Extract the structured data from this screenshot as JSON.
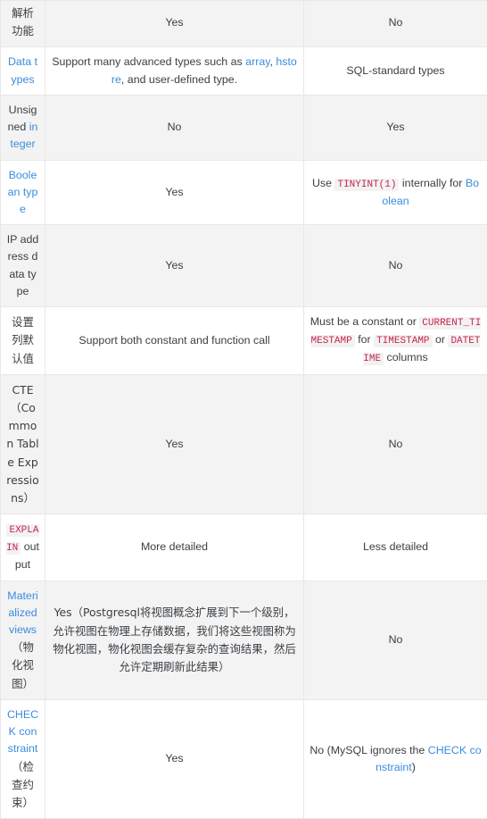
{
  "page": {
    "title": "PostgreSQL vs MySQL feature comparison table",
    "columns": 3,
    "colors": {
      "link": "#3b8cde",
      "code_text": "#c7254e",
      "code_bg": "#f2f2f2",
      "row_alt_bg": "#f3f3f3",
      "row_bg": "#ffffff",
      "border": "#e8e8e8",
      "text": "#3b4045"
    }
  },
  "table": {
    "rows": [
      {
        "id": "parse-function",
        "feature_plain": "解析功能",
        "feature_parts": [
          {
            "text": "解析功能",
            "kind": "text"
          }
        ],
        "postgres": "Yes",
        "postgres_parts": [
          {
            "text": "Yes",
            "kind": "text"
          }
        ],
        "mysql": "No",
        "mysql_parts": [
          {
            "text": "No",
            "kind": "text"
          }
        ],
        "shade": "odd"
      },
      {
        "id": "data-types",
        "feature_plain": "Data types",
        "feature_parts": [
          {
            "text": "Data types",
            "kind": "link"
          }
        ],
        "postgres": "Support many advanced types such as array, hstore, and user-defined type.",
        "postgres_parts": [
          {
            "text": "Support many advanced types such as ",
            "kind": "text"
          },
          {
            "text": "array",
            "kind": "link"
          },
          {
            "text": ", ",
            "kind": "text"
          },
          {
            "text": "hstore",
            "kind": "link"
          },
          {
            "text": ", and user-defined type.",
            "kind": "text"
          }
        ],
        "mysql": "SQL-standard types",
        "mysql_parts": [
          {
            "text": "SQL-standard types",
            "kind": "text"
          }
        ],
        "shade": "even"
      },
      {
        "id": "unsigned-integer",
        "feature_plain": "Unsigned integer",
        "feature_parts": [
          {
            "text": "Unsig ned ",
            "kind": "text"
          },
          {
            "text": "integer",
            "kind": "link"
          }
        ],
        "postgres": "No",
        "postgres_parts": [
          {
            "text": "No",
            "kind": "text"
          }
        ],
        "mysql": "Yes",
        "mysql_parts": [
          {
            "text": "Yes",
            "kind": "text"
          }
        ],
        "shade": "odd"
      },
      {
        "id": "boolean-type",
        "feature_plain": "Boolean type",
        "feature_parts": [
          {
            "text": "Boolean type",
            "kind": "link"
          }
        ],
        "postgres": "Yes",
        "postgres_parts": [
          {
            "text": "Yes",
            "kind": "text"
          }
        ],
        "mysql": "Use TINYINT(1) internally for Boolean",
        "mysql_parts": [
          {
            "text": "Use ",
            "kind": "text"
          },
          {
            "text": "TINYINT(1)",
            "kind": "code"
          },
          {
            "text": " internally for ",
            "kind": "text"
          },
          {
            "text": "Boolean",
            "kind": "link"
          }
        ],
        "shade": "even"
      },
      {
        "id": "ip-address-data-type",
        "feature_plain": "IP address data type",
        "feature_parts": [
          {
            "text": "IP address data type",
            "kind": "text"
          }
        ],
        "postgres": "Yes",
        "postgres_parts": [
          {
            "text": "Yes",
            "kind": "text"
          }
        ],
        "mysql": "No",
        "mysql_parts": [
          {
            "text": "No",
            "kind": "text"
          }
        ],
        "shade": "odd"
      },
      {
        "id": "column-default-value",
        "feature_plain": "设置列默认值",
        "feature_parts": [
          {
            "text": "设置列默认值",
            "kind": "text"
          }
        ],
        "postgres": "Support both constant and function call",
        "postgres_parts": [
          {
            "text": "Support both constant and function call",
            "kind": "text"
          }
        ],
        "mysql": "Must be a constant or CURRENT_TIMESTAMP for TIMESTAMP or DATETIME columns",
        "mysql_parts": [
          {
            "text": "Must be a constant or ",
            "kind": "text"
          },
          {
            "text": "CURRENT_TIMESTAMP",
            "kind": "code"
          },
          {
            "text": " for ",
            "kind": "text"
          },
          {
            "text": "TIMESTAMP",
            "kind": "code"
          },
          {
            "text": " or ",
            "kind": "text"
          },
          {
            "text": "DATETIME",
            "kind": "code"
          },
          {
            "text": " columns",
            "kind": "text"
          }
        ],
        "shade": "even"
      },
      {
        "id": "cte",
        "feature_plain": "CTE（Common Table Expressions）",
        "feature_parts": [
          {
            "text": "CTE（Common Table Expressions）",
            "kind": "text"
          }
        ],
        "postgres": "Yes",
        "postgres_parts": [
          {
            "text": "Yes",
            "kind": "text"
          }
        ],
        "mysql": "No",
        "mysql_parts": [
          {
            "text": "No",
            "kind": "text"
          }
        ],
        "shade": "odd"
      },
      {
        "id": "explain-output",
        "feature_plain": "EXPLAIN output",
        "feature_parts": [
          {
            "text": "EXPLAIN",
            "kind": "code"
          },
          {
            "text": " output",
            "kind": "text"
          }
        ],
        "postgres": "More detailed",
        "postgres_parts": [
          {
            "text": "More detailed",
            "kind": "text"
          }
        ],
        "mysql": "Less detailed",
        "mysql_parts": [
          {
            "text": "Less detailed",
            "kind": "text"
          }
        ],
        "shade": "even"
      },
      {
        "id": "materialized-views",
        "feature_plain": "Materialized views（物化视图）",
        "feature_parts": [
          {
            "text": "Materialized views",
            "kind": "link"
          },
          {
            "text": "（物化视图）",
            "kind": "text"
          }
        ],
        "postgres": "Yes（Postgresql将视图概念扩展到下一个级别，允许视图在物理上存储数据，我们将这些视图称为物化视图，物化视图会缓存复杂的查询结果，然后允许定期刷新此结果）",
        "postgres_parts": [
          {
            "text": "Yes（Postgresql将视图概念扩展到下一个级别，允许视图在物理上存储数据，我们将这些视图称为物化视图，物化视图会缓存复杂的查询结果，然后允许定期刷新此结果）",
            "kind": "text"
          }
        ],
        "mysql": "No",
        "mysql_parts": [
          {
            "text": "No",
            "kind": "text"
          }
        ],
        "shade": "odd"
      },
      {
        "id": "check-constraint",
        "feature_plain": "CHECK constraint（检查约束）",
        "feature_parts": [
          {
            "text": "CHECK constraint",
            "kind": "link"
          },
          {
            "text": "（检查约束）",
            "kind": "text"
          }
        ],
        "postgres": "Yes",
        "postgres_parts": [
          {
            "text": "Yes",
            "kind": "text"
          }
        ],
        "mysql": "No (MySQL ignores the CHECK constraint)",
        "mysql_parts": [
          {
            "text": "No (MySQL ignores the ",
            "kind": "text"
          },
          {
            "text": "CHECK constraint",
            "kind": "link"
          },
          {
            "text": ")",
            "kind": "text"
          }
        ],
        "shade": "even"
      }
    ]
  }
}
